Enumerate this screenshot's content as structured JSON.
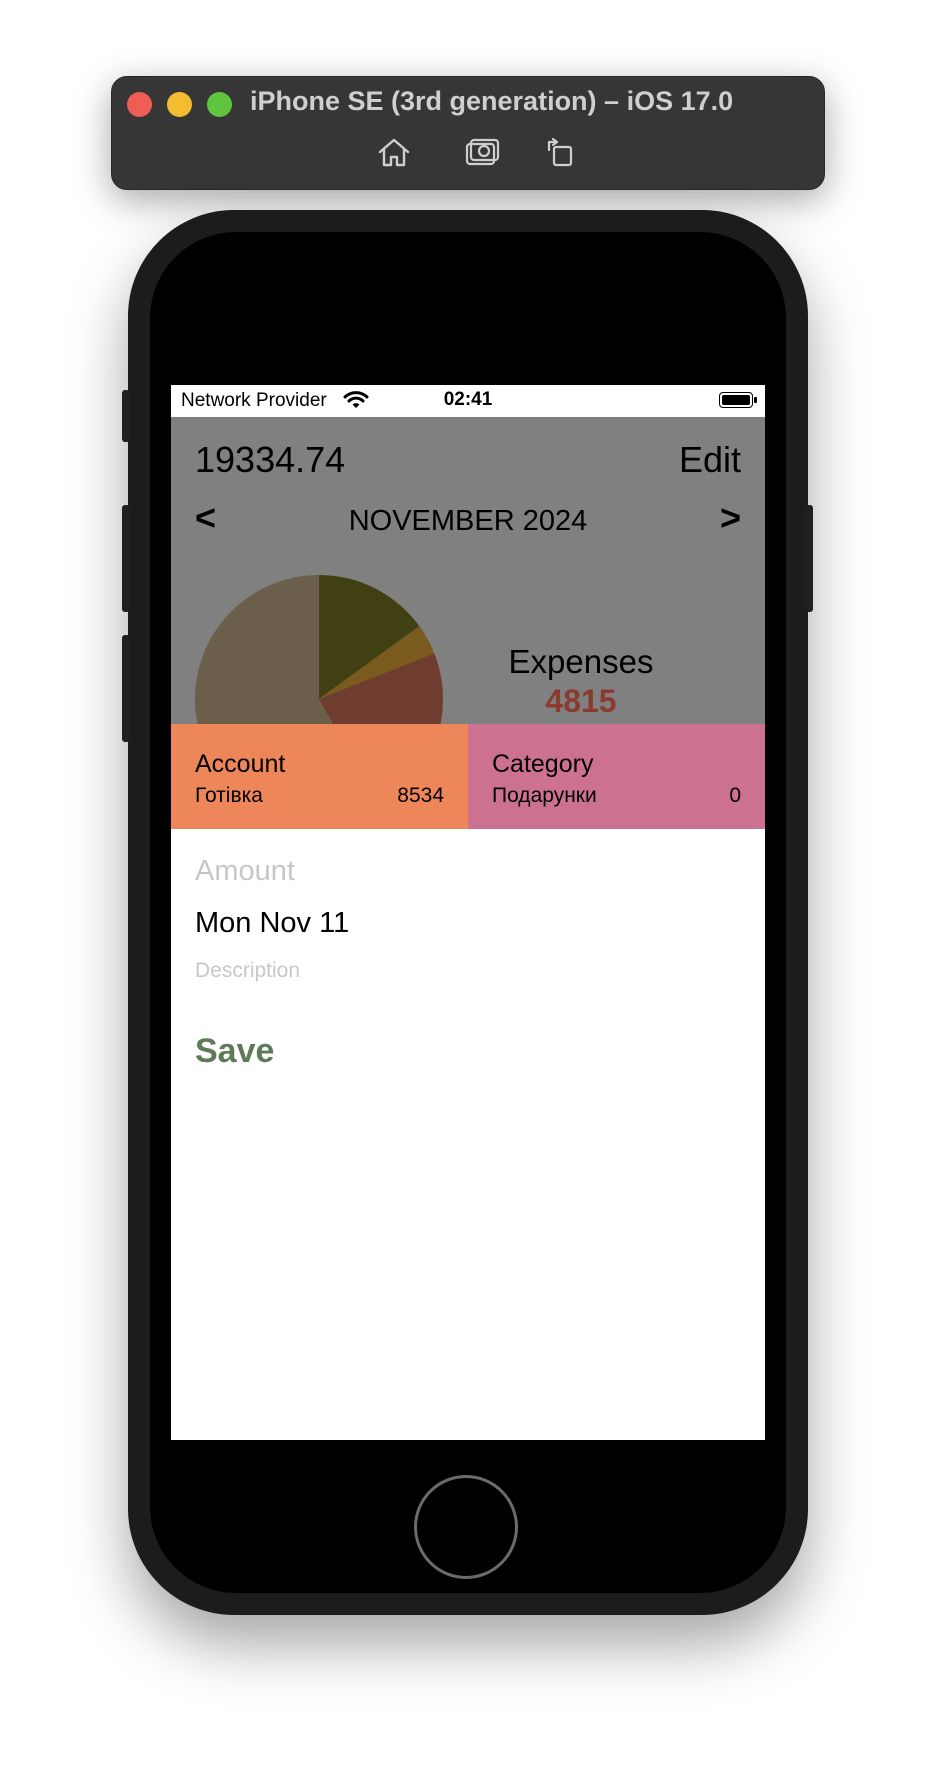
{
  "simulator": {
    "title": "iPhone SE (3rd generation) – iOS 17.0",
    "toolbar_icons": [
      "home-icon",
      "screenshot-icon",
      "rotate-icon"
    ]
  },
  "status_bar": {
    "carrier": "Network Provider",
    "time": "02:41"
  },
  "header": {
    "balance": "19334.74",
    "edit_label": "Edit",
    "prev_label": "<",
    "next_label": ">",
    "month": "NOVEMBER 2024"
  },
  "summary": {
    "expenses_label": "Expenses",
    "expenses_value": "4815",
    "expenses_color": "#8b3a2e"
  },
  "chart_data": {
    "type": "pie",
    "note_visible": "partially visible, top portion only",
    "slices": [
      {
        "value": 15,
        "color": "#404013"
      },
      {
        "value": 4,
        "color": "#7b5a1e"
      },
      {
        "value": 23,
        "color": "#6e3d2f"
      },
      {
        "value": 58,
        "color": "#6b5e4b"
      }
    ]
  },
  "account_card": {
    "title": "Account",
    "name": "Готівка",
    "amount": "8534",
    "color": "#ed8659"
  },
  "category_card": {
    "title": "Category",
    "name": "Подарунки",
    "amount": "0",
    "color": "#cc7191"
  },
  "form": {
    "amount_placeholder": "Amount",
    "date": "Mon Nov 11",
    "description_placeholder": "Description",
    "save_label": "Save",
    "save_color": "#5e7a58"
  }
}
